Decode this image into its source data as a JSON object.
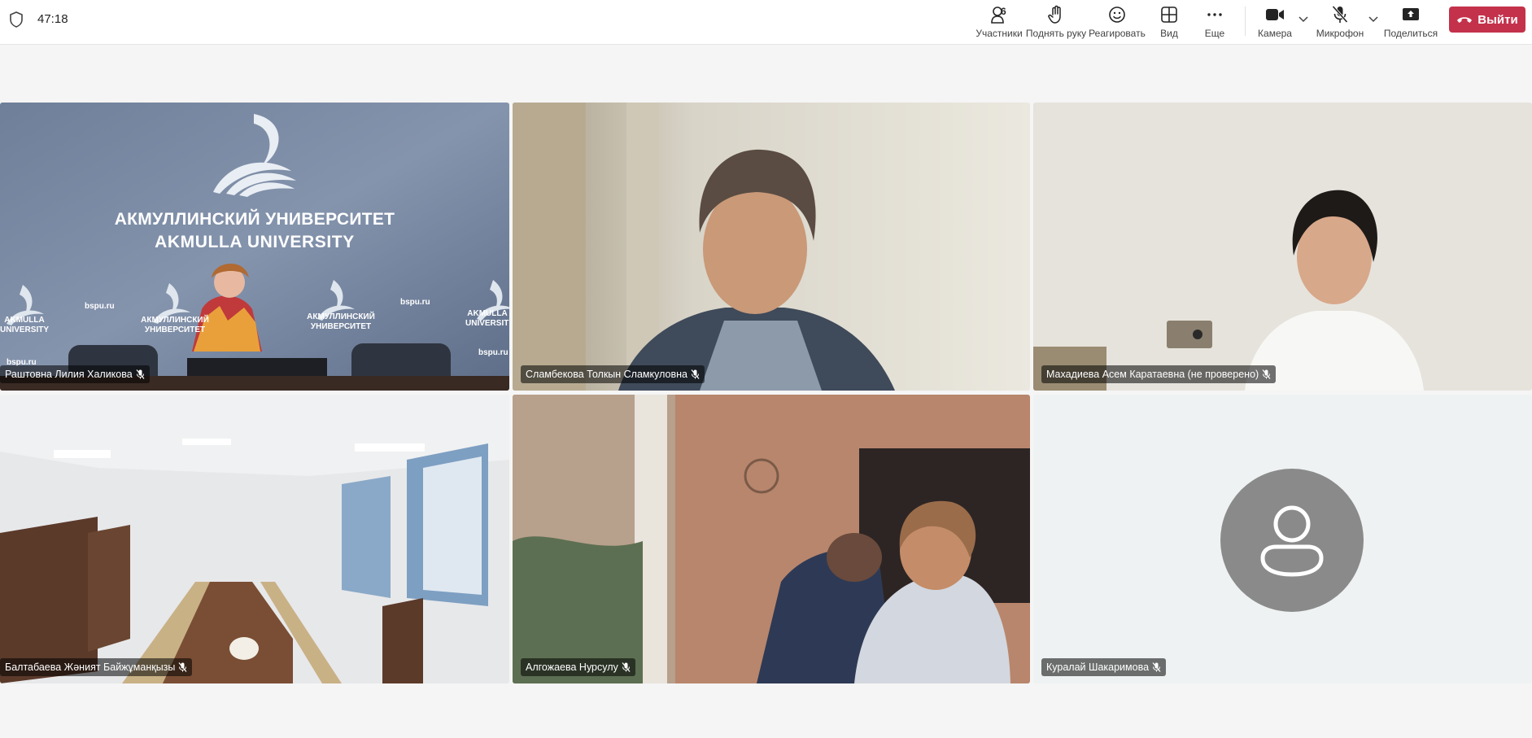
{
  "header": {
    "timer": "47:18",
    "participants_count": "6",
    "controls": {
      "participants": "Участники",
      "raise_hand": "Поднять руку",
      "react": "Реагировать",
      "view": "Вид",
      "more": "Еще",
      "camera": "Камера",
      "microphone": "Микрофон",
      "share": "Поделиться"
    },
    "leave_label": "Выйти",
    "leave_color": "#c4314b"
  },
  "tiles": [
    {
      "name": "Раштовна Лилия Халикова",
      "muted": true
    },
    {
      "name": "Сламбекова Толкын Сламкуловна",
      "muted": true
    },
    {
      "name": "Махадиева Асем Каратаевна (не проверено)",
      "muted": true
    },
    {
      "name": "Балтабаева Жәният Байжұманқызы",
      "muted": true
    },
    {
      "name": "Алгожаева Нурсулу",
      "muted": true
    },
    {
      "name": "Куралай Шакаримова",
      "muted": true
    }
  ],
  "video_tile_1": {
    "logo_line_1": "АКМУЛЛИНСКИЙ УНИВЕРСИТЕТ",
    "logo_line_2": "AKMULLA UNIVERSITY",
    "site": "bspu.ru",
    "small_logo_ru": "АКМУЛЛИНСКИЙ УНИВЕРСИТЕТ",
    "small_logo_short": "AKMULLA UNIVERSITY"
  }
}
